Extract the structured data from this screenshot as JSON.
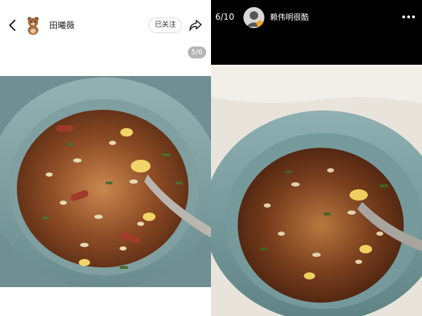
{
  "left_post": {
    "author_name": "田曦薇",
    "follow_label": "已关注",
    "image_counter": "5/6",
    "icons": {
      "back": "chevron-left-icon",
      "avatar": "bear-avatar-icon",
      "share": "share-arrow-icon"
    }
  },
  "right_post": {
    "image_counter": "6/10",
    "author_name": "赖伟明很酷",
    "icons": {
      "avatar": "user-avatar-icon",
      "verified": "verified-badge-icon",
      "more": "more-dots-icon"
    }
  },
  "colors": {
    "left_background": "#ffffff",
    "right_background": "#000000",
    "bowl": "#7a9c9c",
    "badge_background": "#8a8a8a"
  }
}
